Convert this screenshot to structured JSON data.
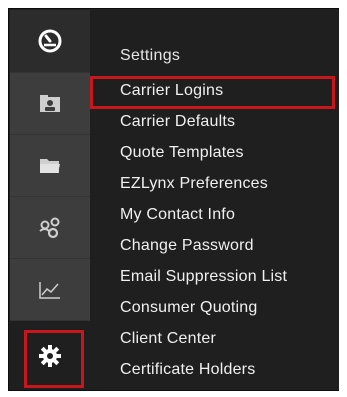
{
  "rail": {
    "items": [
      {
        "name": "dashboard-icon",
        "active": false
      },
      {
        "name": "contacts-icon",
        "active": false
      },
      {
        "name": "folder-icon",
        "active": false
      },
      {
        "name": "people-icon",
        "active": false
      },
      {
        "name": "chart-icon",
        "active": false
      },
      {
        "name": "gear-icon",
        "active": true
      }
    ]
  },
  "settings_menu": {
    "title": "Settings",
    "items": [
      {
        "label": "Carrier Logins",
        "highlighted": true
      },
      {
        "label": "Carrier Defaults"
      },
      {
        "label": "Quote Templates"
      },
      {
        "label": "EZLynx Preferences"
      },
      {
        "label": "My Contact Info"
      },
      {
        "label": "Change Password"
      },
      {
        "label": "Email Suppression List"
      },
      {
        "label": "Consumer Quoting"
      },
      {
        "label": "Client Center"
      },
      {
        "label": "Certificate Holders"
      }
    ]
  },
  "colors": {
    "highlight": "#c8161d",
    "rail_bg": "#3d3d3d",
    "menu_bg": "#1f1f1f",
    "text": "#f0f0f0"
  }
}
